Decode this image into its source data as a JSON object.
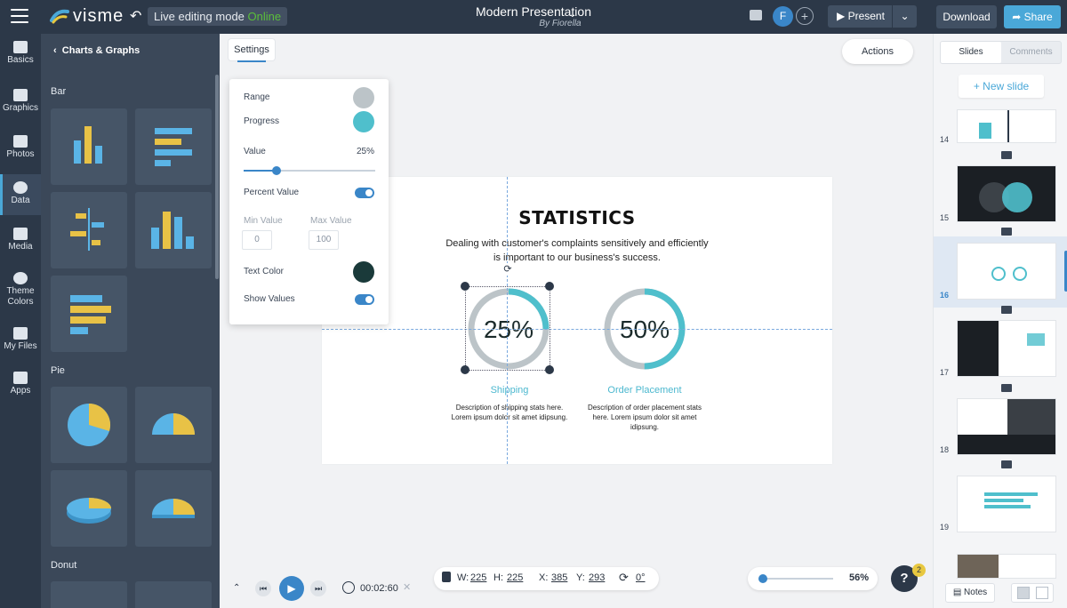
{
  "topbar": {
    "logo": "visme",
    "live_mode_label": "Live editing mode",
    "live_status": "Online",
    "presentation_title": "Modern Presentation",
    "presentation_author": "By Fiorella",
    "avatar_initial": "F",
    "present_label": "Present",
    "download_label": "Download",
    "share_label": "Share"
  },
  "leftnav": {
    "items": [
      {
        "label": "Basics",
        "icon": "basics-icon"
      },
      {
        "label": "Graphics",
        "icon": "graphics-icon"
      },
      {
        "label": "Photos",
        "icon": "photos-icon"
      },
      {
        "label": "Data",
        "icon": "data-icon",
        "active": true
      },
      {
        "label": "Media",
        "icon": "media-icon"
      },
      {
        "label": "Theme Colors",
        "icon": "theme-colors-icon"
      },
      {
        "label": "My Files",
        "icon": "my-files-icon"
      },
      {
        "label": "Apps",
        "icon": "apps-icon"
      }
    ]
  },
  "panel": {
    "back_title": "Charts & Graphs",
    "sections": [
      "Bar",
      "Pie",
      "Donut"
    ]
  },
  "canvas": {
    "settings_tab": "Settings",
    "actions_label": "Actions"
  },
  "settings": {
    "range_label": "Range",
    "range_color": "#bcc4c8",
    "progress_label": "Progress",
    "progress_color": "#4fbfcc",
    "value_label": "Value",
    "value_text": "25%",
    "value_fraction": 0.25,
    "percent_value_label": "Percent Value",
    "min_value_label": "Min Value",
    "max_value_label": "Max Value",
    "min_value": "0",
    "max_value": "100",
    "text_color_label": "Text Color",
    "text_color": "#1a3a3a",
    "show_values_label": "Show Values"
  },
  "slide": {
    "title": "STATISTICS",
    "subtitle": "Dealing with customer's complaints sensitively and efficiently is important to our business's success.",
    "rings": [
      {
        "value_text": "25%",
        "fraction": 0.25,
        "label": "Shipping",
        "desc": "Description of shipping stats here. Lorem ipsum dolor sit amet idipsung."
      },
      {
        "value_text": "50%",
        "fraction": 0.5,
        "label": "Order Placement",
        "desc": "Description of order placement stats here. Lorem ipsum dolor sit amet idipsung."
      }
    ]
  },
  "bottom": {
    "timer": "00:02:60",
    "w_label": "W:",
    "w_value": "225",
    "h_label": "H:",
    "h_value": "225",
    "x_label": "X:",
    "x_value": "385",
    "y_label": "Y:",
    "y_value": "293",
    "rotation": "0°",
    "zoom": "56%",
    "help": "?",
    "help_badge": "2"
  },
  "rightpanel": {
    "tab_slides": "Slides",
    "tab_comments": "Comments",
    "new_slide": "+ New slide",
    "slide_numbers": [
      "14",
      "15",
      "16",
      "17",
      "18",
      "19"
    ],
    "notes_label": "Notes"
  },
  "colors": {
    "dark_navy": "#2c3848",
    "accent_blue": "#3a86c8",
    "share_blue": "#4aa8d8",
    "teal": "#4fbfcc",
    "grey_ring": "#bcc4c8"
  }
}
